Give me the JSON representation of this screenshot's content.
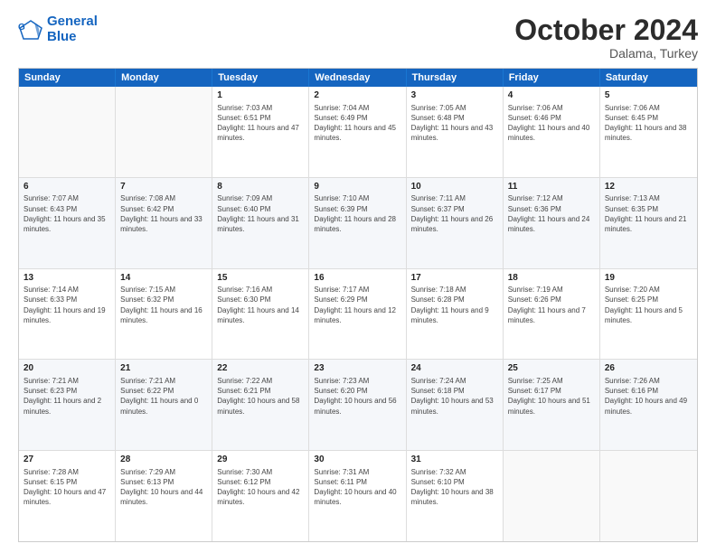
{
  "header": {
    "logo_general": "General",
    "logo_blue": "Blue",
    "month": "October 2024",
    "location": "Dalama, Turkey"
  },
  "weekdays": [
    "Sunday",
    "Monday",
    "Tuesday",
    "Wednesday",
    "Thursday",
    "Friday",
    "Saturday"
  ],
  "rows": [
    [
      {
        "day": "",
        "sun": "",
        "set": "",
        "daylight": ""
      },
      {
        "day": "",
        "sun": "",
        "set": "",
        "daylight": ""
      },
      {
        "day": "1",
        "sun": "Sunrise: 7:03 AM",
        "set": "Sunset: 6:51 PM",
        "daylight": "Daylight: 11 hours and 47 minutes."
      },
      {
        "day": "2",
        "sun": "Sunrise: 7:04 AM",
        "set": "Sunset: 6:49 PM",
        "daylight": "Daylight: 11 hours and 45 minutes."
      },
      {
        "day": "3",
        "sun": "Sunrise: 7:05 AM",
        "set": "Sunset: 6:48 PM",
        "daylight": "Daylight: 11 hours and 43 minutes."
      },
      {
        "day": "4",
        "sun": "Sunrise: 7:06 AM",
        "set": "Sunset: 6:46 PM",
        "daylight": "Daylight: 11 hours and 40 minutes."
      },
      {
        "day": "5",
        "sun": "Sunrise: 7:06 AM",
        "set": "Sunset: 6:45 PM",
        "daylight": "Daylight: 11 hours and 38 minutes."
      }
    ],
    [
      {
        "day": "6",
        "sun": "Sunrise: 7:07 AM",
        "set": "Sunset: 6:43 PM",
        "daylight": "Daylight: 11 hours and 35 minutes."
      },
      {
        "day": "7",
        "sun": "Sunrise: 7:08 AM",
        "set": "Sunset: 6:42 PM",
        "daylight": "Daylight: 11 hours and 33 minutes."
      },
      {
        "day": "8",
        "sun": "Sunrise: 7:09 AM",
        "set": "Sunset: 6:40 PM",
        "daylight": "Daylight: 11 hours and 31 minutes."
      },
      {
        "day": "9",
        "sun": "Sunrise: 7:10 AM",
        "set": "Sunset: 6:39 PM",
        "daylight": "Daylight: 11 hours and 28 minutes."
      },
      {
        "day": "10",
        "sun": "Sunrise: 7:11 AM",
        "set": "Sunset: 6:37 PM",
        "daylight": "Daylight: 11 hours and 26 minutes."
      },
      {
        "day": "11",
        "sun": "Sunrise: 7:12 AM",
        "set": "Sunset: 6:36 PM",
        "daylight": "Daylight: 11 hours and 24 minutes."
      },
      {
        "day": "12",
        "sun": "Sunrise: 7:13 AM",
        "set": "Sunset: 6:35 PM",
        "daylight": "Daylight: 11 hours and 21 minutes."
      }
    ],
    [
      {
        "day": "13",
        "sun": "Sunrise: 7:14 AM",
        "set": "Sunset: 6:33 PM",
        "daylight": "Daylight: 11 hours and 19 minutes."
      },
      {
        "day": "14",
        "sun": "Sunrise: 7:15 AM",
        "set": "Sunset: 6:32 PM",
        "daylight": "Daylight: 11 hours and 16 minutes."
      },
      {
        "day": "15",
        "sun": "Sunrise: 7:16 AM",
        "set": "Sunset: 6:30 PM",
        "daylight": "Daylight: 11 hours and 14 minutes."
      },
      {
        "day": "16",
        "sun": "Sunrise: 7:17 AM",
        "set": "Sunset: 6:29 PM",
        "daylight": "Daylight: 11 hours and 12 minutes."
      },
      {
        "day": "17",
        "sun": "Sunrise: 7:18 AM",
        "set": "Sunset: 6:28 PM",
        "daylight": "Daylight: 11 hours and 9 minutes."
      },
      {
        "day": "18",
        "sun": "Sunrise: 7:19 AM",
        "set": "Sunset: 6:26 PM",
        "daylight": "Daylight: 11 hours and 7 minutes."
      },
      {
        "day": "19",
        "sun": "Sunrise: 7:20 AM",
        "set": "Sunset: 6:25 PM",
        "daylight": "Daylight: 11 hours and 5 minutes."
      }
    ],
    [
      {
        "day": "20",
        "sun": "Sunrise: 7:21 AM",
        "set": "Sunset: 6:23 PM",
        "daylight": "Daylight: 11 hours and 2 minutes."
      },
      {
        "day": "21",
        "sun": "Sunrise: 7:21 AM",
        "set": "Sunset: 6:22 PM",
        "daylight": "Daylight: 11 hours and 0 minutes."
      },
      {
        "day": "22",
        "sun": "Sunrise: 7:22 AM",
        "set": "Sunset: 6:21 PM",
        "daylight": "Daylight: 10 hours and 58 minutes."
      },
      {
        "day": "23",
        "sun": "Sunrise: 7:23 AM",
        "set": "Sunset: 6:20 PM",
        "daylight": "Daylight: 10 hours and 56 minutes."
      },
      {
        "day": "24",
        "sun": "Sunrise: 7:24 AM",
        "set": "Sunset: 6:18 PM",
        "daylight": "Daylight: 10 hours and 53 minutes."
      },
      {
        "day": "25",
        "sun": "Sunrise: 7:25 AM",
        "set": "Sunset: 6:17 PM",
        "daylight": "Daylight: 10 hours and 51 minutes."
      },
      {
        "day": "26",
        "sun": "Sunrise: 7:26 AM",
        "set": "Sunset: 6:16 PM",
        "daylight": "Daylight: 10 hours and 49 minutes."
      }
    ],
    [
      {
        "day": "27",
        "sun": "Sunrise: 7:28 AM",
        "set": "Sunset: 6:15 PM",
        "daylight": "Daylight: 10 hours and 47 minutes."
      },
      {
        "day": "28",
        "sun": "Sunrise: 7:29 AM",
        "set": "Sunset: 6:13 PM",
        "daylight": "Daylight: 10 hours and 44 minutes."
      },
      {
        "day": "29",
        "sun": "Sunrise: 7:30 AM",
        "set": "Sunset: 6:12 PM",
        "daylight": "Daylight: 10 hours and 42 minutes."
      },
      {
        "day": "30",
        "sun": "Sunrise: 7:31 AM",
        "set": "Sunset: 6:11 PM",
        "daylight": "Daylight: 10 hours and 40 minutes."
      },
      {
        "day": "31",
        "sun": "Sunrise: 7:32 AM",
        "set": "Sunset: 6:10 PM",
        "daylight": "Daylight: 10 hours and 38 minutes."
      },
      {
        "day": "",
        "sun": "",
        "set": "",
        "daylight": ""
      },
      {
        "day": "",
        "sun": "",
        "set": "",
        "daylight": ""
      }
    ]
  ]
}
